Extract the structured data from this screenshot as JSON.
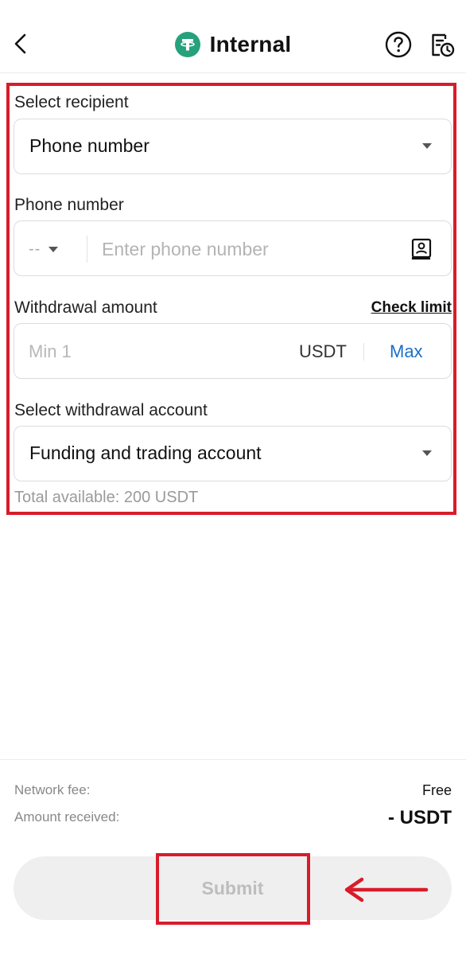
{
  "header": {
    "title": "Internal",
    "back_icon": "chevron-left-icon",
    "coin_icon": "tether-icon",
    "help_icon": "help-circle-icon",
    "history_icon": "history-document-icon"
  },
  "form": {
    "recipient": {
      "label": "Select recipient",
      "value": "Phone number"
    },
    "phone": {
      "label": "Phone number",
      "country_code": "--",
      "placeholder": "Enter phone number"
    },
    "amount": {
      "label": "Withdrawal amount",
      "check_limit": "Check limit",
      "placeholder": "Min 1",
      "unit": "USDT",
      "max": "Max"
    },
    "account": {
      "label": "Select withdrawal account",
      "value": "Funding and trading account",
      "total_available": "Total available: 200 USDT"
    }
  },
  "summary": {
    "network_fee_label": "Network fee:",
    "network_fee_value": "Free",
    "amount_received_label": "Amount received:",
    "amount_received_value": "- USDT"
  },
  "submit_label": "Submit",
  "colors": {
    "accent_blue": "#1a6fc9",
    "tether_green": "#26a17b",
    "annotation_red": "#d81c2a",
    "disabled_button_bg": "#efefef"
  }
}
